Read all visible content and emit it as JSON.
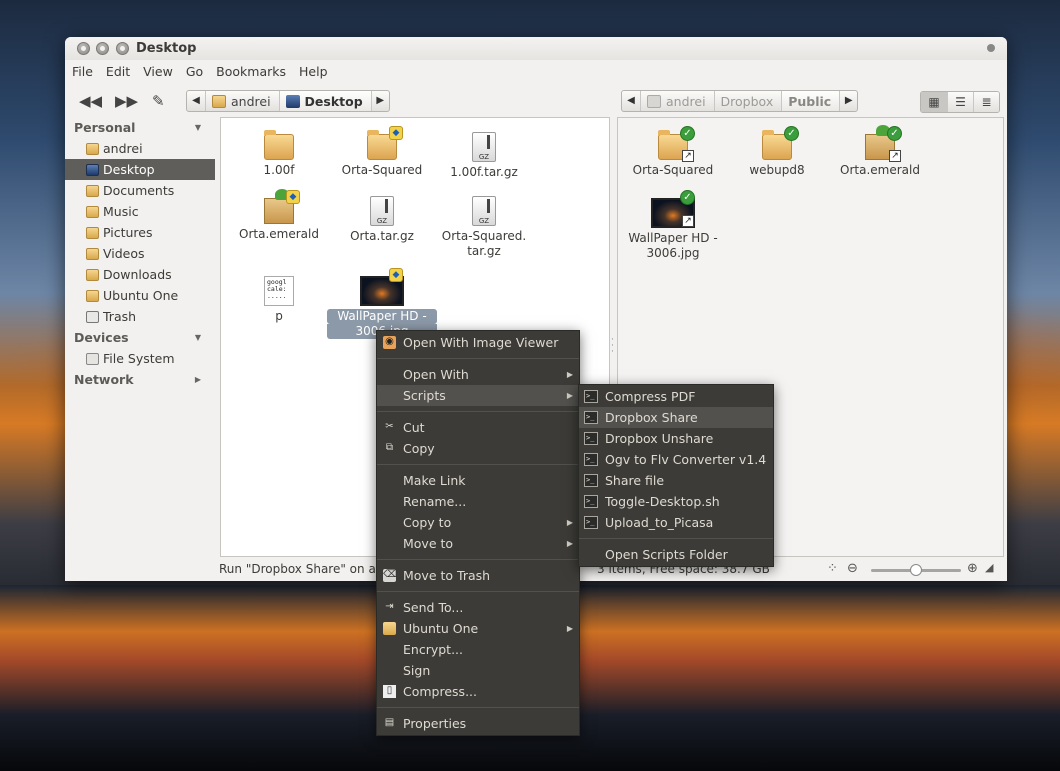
{
  "window": {
    "title": "Desktop",
    "menubar": [
      "File",
      "Edit",
      "View",
      "Go",
      "Bookmarks",
      "Help"
    ]
  },
  "pathbar_left": {
    "crumbs": [
      "andrei",
      "Desktop"
    ]
  },
  "pathbar_right": {
    "crumbs": [
      "andrei",
      "Dropbox",
      "Public"
    ]
  },
  "sidebar": {
    "personal_label": "Personal",
    "personal_items": [
      "andrei",
      "Desktop",
      "Documents",
      "Music",
      "Pictures",
      "Videos",
      "Downloads",
      "Ubuntu One",
      "Trash"
    ],
    "devices_label": "Devices",
    "devices_items": [
      "File System"
    ],
    "network_label": "Network"
  },
  "left_pane": {
    "files": [
      "1.00f",
      "Orta-Squared",
      "1.00f.tar.gz",
      "Orta.emerald",
      "Orta.tar.gz",
      "Orta-Squared.",
      "tar.gz",
      "p",
      "WallPaper HD -",
      "3006.jpg"
    ],
    "textdoc_lines": [
      "googl",
      "cale:",
      "....."
    ],
    "archive_label": "GZ"
  },
  "right_pane": {
    "files": [
      "Orta-Squared",
      "webupd8",
      "Orta.emerald",
      "WallPaper HD -",
      "3006.jpg"
    ]
  },
  "status": {
    "left": "Run \"Dropbox Share\" on an",
    "right": "3 items, Free space: 38.7 GB",
    "zoom_level": 0.5
  },
  "context_menu": {
    "items": [
      "Open With Image Viewer",
      "Open With",
      "Scripts",
      "Cut",
      "Copy",
      "Make Link",
      "Rename...",
      "Copy to",
      "Move to",
      "Move to Trash",
      "Send To...",
      "Ubuntu One",
      "Encrypt...",
      "Sign",
      "Compress...",
      "Properties"
    ]
  },
  "scripts_menu": {
    "items": [
      "Compress PDF",
      "Dropbox Share",
      "Dropbox Unshare",
      "Ogv to Flv Converter v1.4",
      "Share file",
      "Toggle-Desktop.sh",
      "Upload_to_Picasa",
      "Open Scripts Folder"
    ]
  }
}
